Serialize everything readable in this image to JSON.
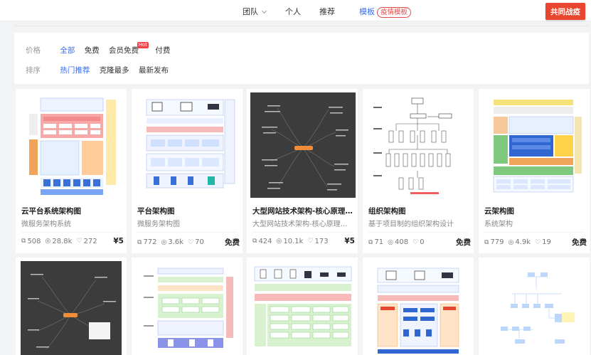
{
  "nav": {
    "team": "团队",
    "personal": "个人",
    "recommend": "推荐",
    "templates": "模板",
    "templates_badge": "疫情模板",
    "cta": "共同战疫"
  },
  "filters": {
    "price": {
      "label": "价格",
      "options": [
        "全部",
        "免费",
        "会员免费",
        "付费"
      ],
      "selected": "全部",
      "hot_tag": "Hot"
    },
    "sort": {
      "label": "排序",
      "options": [
        "热门推荐",
        "克隆最多",
        "最新发布"
      ],
      "selected": "热门推荐"
    }
  },
  "cards": [
    {
      "title": "云平台系统架构图",
      "desc": "微服务架构系统",
      "pages": "508",
      "views": "28.8k",
      "likes": "272",
      "price": "¥5"
    },
    {
      "title": "平台架构图",
      "desc": "微服务架构图",
      "pages": "772",
      "views": "3.6k",
      "likes": "70",
      "price": "免费"
    },
    {
      "title": "大型网站技术架构-核心原理与…",
      "desc": "大型网站技术架构-核心原理…",
      "pages": "424",
      "views": "10.1k",
      "likes": "173",
      "price": "¥5"
    },
    {
      "title": "组织架构图",
      "desc": "基于项目制的组织架构设计",
      "pages": "71",
      "views": "408",
      "likes": "0",
      "price": "免费"
    },
    {
      "title": "云架构图",
      "desc": "系统架构",
      "pages": "779",
      "views": "4.9k",
      "likes": "19",
      "price": "免费"
    }
  ],
  "icons": {
    "pages": "copy-icon",
    "views": "eye-icon",
    "likes": "thumb-up-icon"
  },
  "colors": {
    "accent": "#3b6ef5",
    "cta": "#e8462f",
    "hot": "#f3414a"
  }
}
